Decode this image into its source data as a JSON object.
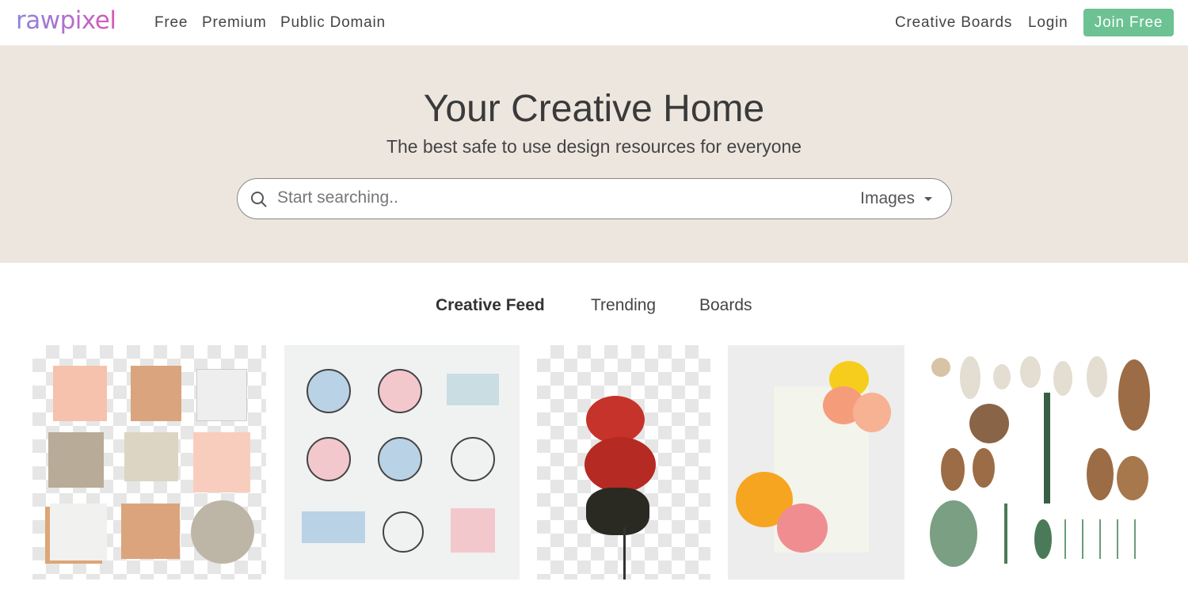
{
  "nav": {
    "logo": "rawpixel",
    "links": [
      "Free",
      "Premium",
      "Public Domain"
    ],
    "creative_boards": "Creative Boards",
    "login": "Login",
    "join": "Join Free",
    "join_color": "#6cc292"
  },
  "hero": {
    "title": "Your Creative Home",
    "subtitle": "The best safe to use design resources for everyone",
    "search_placeholder": "Start searching..",
    "category": "Images",
    "bg_color": "#ede6df"
  },
  "tabs": [
    {
      "label": "Creative Feed",
      "active": true
    },
    {
      "label": "Trending",
      "active": false
    },
    {
      "label": "Boards",
      "active": false
    }
  ],
  "feed": {
    "items": [
      "paper-notes",
      "botanical-logos",
      "red-rose",
      "paper-flowers",
      "pine-cones"
    ]
  }
}
